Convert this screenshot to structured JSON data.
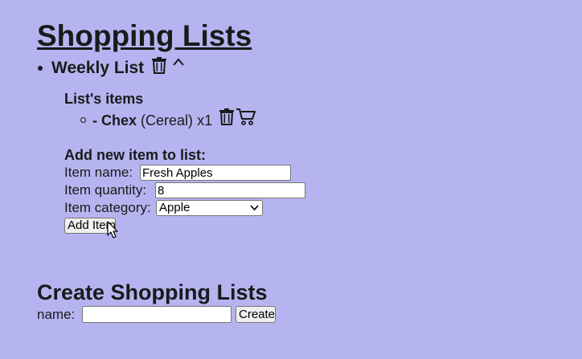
{
  "page": {
    "title": "Shopping Lists"
  },
  "list": {
    "name": "Weekly List",
    "items_heading": "List's items",
    "items": [
      {
        "name": "- Chex",
        "category": "(Cereal)",
        "quantity": "x1"
      }
    ]
  },
  "add_item_form": {
    "heading": "Add new item to list:",
    "name_label": "Item name:",
    "name_value": "Fresh Apples",
    "quantity_label": "Item quantity:",
    "quantity_value": "8",
    "category_label": "Item category:",
    "category_selected": "Apple",
    "submit_label": "Add Item"
  },
  "create_form": {
    "heading": "Create Shopping Lists",
    "name_label": "name:",
    "name_value": "",
    "submit_label": "Create"
  },
  "icons": {
    "delete_list": "trash-icon",
    "collapse_list": "chevron-up-icon",
    "delete_item": "trash-icon",
    "cart_item": "shopping-cart-icon",
    "mouse_cursor": "mouse-pointer-icon"
  },
  "colors": {
    "background": "#b6b4f0"
  }
}
